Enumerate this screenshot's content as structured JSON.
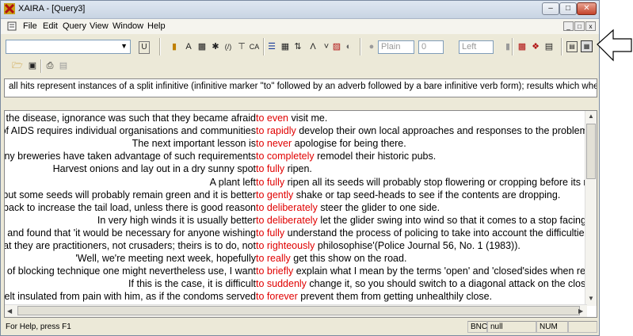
{
  "window": {
    "title": "XAIRA - [Query3]"
  },
  "menu": [
    "File",
    "Edit",
    "Query",
    "View",
    "Window",
    "Help"
  ],
  "toolbar": {
    "style_value": "Plain",
    "size_value": "0",
    "align_value": "Left",
    "u_label": "U"
  },
  "info_text": "all hits represent instances of a split infinitive (infinitive marker \"to\" followed by an adverb followed by a bare infinitive verb form); results which whe",
  "concordance": [
    {
      "left": "f the disease, ignorance was such that they became afraid",
      "node": "to even",
      "right": "visit me."
    },
    {
      "left": "of AIDS requires individual organisations and communities",
      "node": "to rapidly",
      "right": "develop their own local approaches and responses to the problem a"
    },
    {
      "left": "The next important lesson is",
      "node": "to never",
      "right": "apologise for being there."
    },
    {
      "left": "any breweries have taken advantage of such requirements",
      "node": "to completely",
      "right": "remodel their historic pubs."
    },
    {
      "left": "Harvest onions and lay out in a dry sunny spot",
      "node": "to fully",
      "right": "ripen."
    },
    {
      "left": "A plant left",
      "node": "to fully",
      "right": "ripen all its seeds will probably stop flowering or cropping before its ne"
    },
    {
      "left": "but some seeds will probably remain green and it is better",
      "node": "to gently",
      "right": "shake or tap seed-heads to see if the contents are dropping."
    },
    {
      "left": "back to increase the tail load, unless there is good reason",
      "node": "to deliberately",
      "right": "steer the glider to one side."
    },
    {
      "left": "In very high winds it is usually better",
      "node": "to deliberately",
      "right": "let the glider swing into wind so that it comes to a stop facing d"
    },
    {
      "left": "e and found that 'it would be necessary for anyone wishing",
      "node": "to fully",
      "right": "understand the process of policing to take into account the difficulties"
    },
    {
      "left": "at they are practitioners, not crusaders; theirs is to do, not",
      "node": "to righteously",
      "right": "philosophise'(Police Journal 56, No. 1 (1983))."
    },
    {
      "left": "'Well, we're meeting next week, hopefully",
      "node": "to really",
      "right": "get this show on the road."
    },
    {
      "left": "s of blocking technique one might nevertheless use, I want",
      "node": "to briefly",
      "right": "explain what I mean by the terms 'open' and 'closed'sides when refe"
    },
    {
      "left": "If this is the case, it is difficult",
      "node": "to suddenly",
      "right": "change it, so you should switch to a diagonal attack on the closed"
    },
    {
      "left": "felt insulated from pain with him, as if the condoms served",
      "node": "to forever",
      "right": "prevent them from getting unhealthily close."
    }
  ],
  "status": {
    "help": "For Help, press F1",
    "mode": "BNC",
    "value": "null",
    "num": "NUM"
  },
  "colors": {
    "node": "#e00000",
    "titlebar": "#d5dfec"
  }
}
